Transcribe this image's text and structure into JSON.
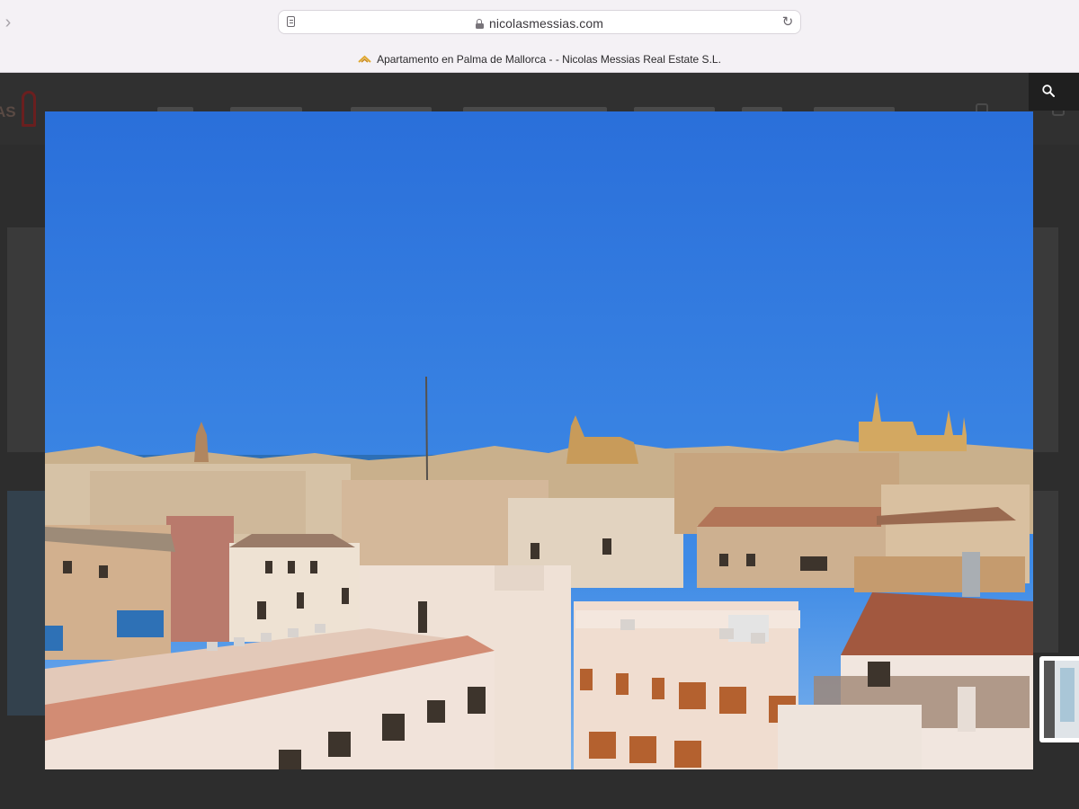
{
  "browser": {
    "url": "nicolasmessias.com",
    "tab_title": "Apartamento en Palma de Mallorca - - Nicolas Messias Real Estate S.L.",
    "icons": {
      "forward": "chevron-right-icon",
      "reader": "reader-mode-icon",
      "lock": "lock-icon",
      "reload": "reload-icon",
      "favicon": "site-favicon-icon"
    }
  },
  "site": {
    "header": {
      "search_icon": "search-icon"
    }
  },
  "lightbox": {
    "image_description_icon": "photo",
    "thumbnail_icon": "next-thumbnail"
  },
  "colors": {
    "sky": "#2f78dd",
    "overlay": "#2d2d2d",
    "browser_bg": "#f4f1f5"
  }
}
